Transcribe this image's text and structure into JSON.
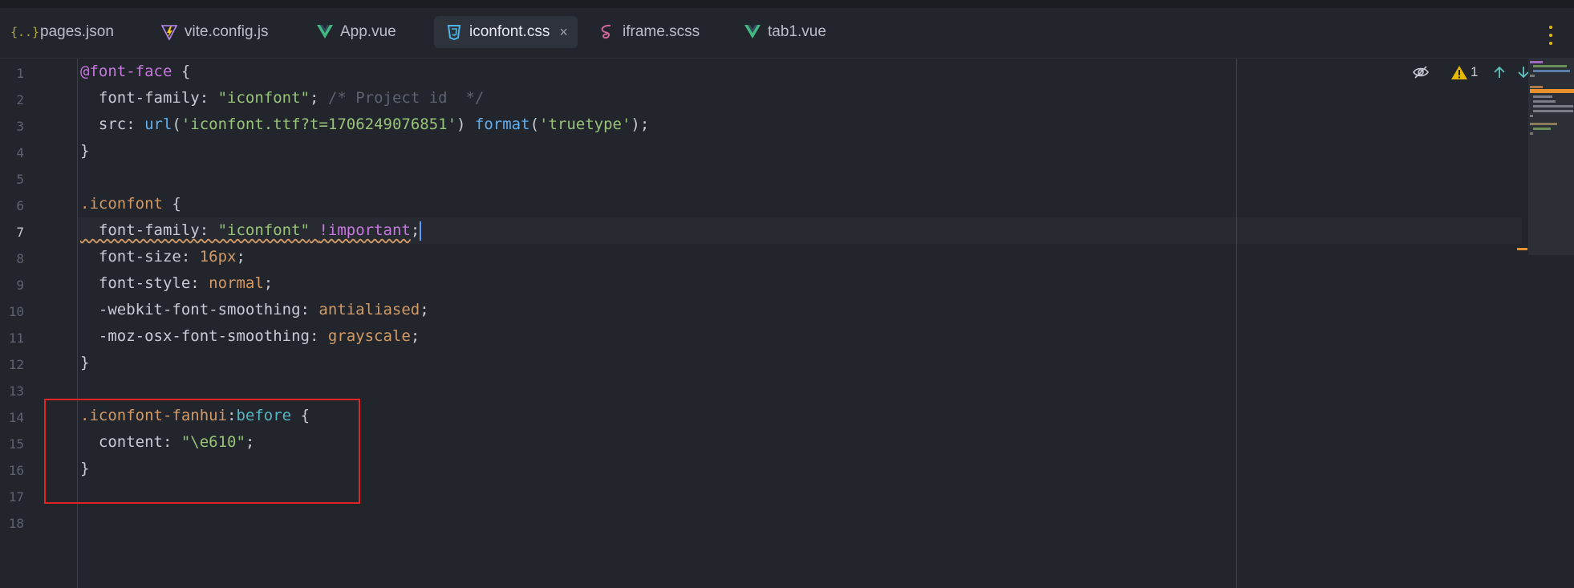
{
  "tabs": [
    {
      "name": "pages.json",
      "icon": "json-braces-icon",
      "active": false
    },
    {
      "name": "vite.config.js",
      "icon": "vite-icon",
      "active": false
    },
    {
      "name": "App.vue",
      "icon": "vue-icon",
      "active": false
    },
    {
      "name": "iconfont.css",
      "icon": "css-icon",
      "active": true,
      "close": "×"
    },
    {
      "name": "iframe.scss",
      "icon": "sass-icon",
      "active": false
    },
    {
      "name": "tab1.vue",
      "icon": "vue-icon",
      "active": false
    }
  ],
  "json_icon_text": "{..}",
  "line_numbers": [
    "1",
    "2",
    "3",
    "4",
    "5",
    "6",
    "7",
    "8",
    "9",
    "10",
    "11",
    "12",
    "13",
    "14",
    "15",
    "16",
    "17",
    "18"
  ],
  "current_line": "7",
  "code": {
    "l1": {
      "at": "@font-face",
      "brace": " {"
    },
    "l2": {
      "prop": "  font-family: ",
      "val": "\"iconfont\"",
      "semi": "; ",
      "comment": "/* Project id  */"
    },
    "l3": {
      "prop": "  src: ",
      "url_fn": "url",
      "p1": "(",
      "url_val": "'iconfont.ttf?t=1706249076851'",
      "p2": ") ",
      "fmt_fn": "format",
      "p3": "(",
      "fmt_val": "'truetype'",
      "p4": ");"
    },
    "l4": "}",
    "l6": {
      "sel": ".iconfont",
      "brace": " {"
    },
    "l7": {
      "prop": "  font-family: ",
      "val": "\"iconfont\"",
      "sp": " ",
      "imp": "!important",
      "semi": ";"
    },
    "l8": {
      "prop": "  font-size: ",
      "val": "16px",
      "semi": ";"
    },
    "l9": {
      "prop": "  font-style: ",
      "val": "normal",
      "semi": ";"
    },
    "l10": {
      "prop": "  -webkit-font-smoothing: ",
      "val": "antialiased",
      "semi": ";"
    },
    "l11": {
      "prop": "  -moz-osx-font-smoothing: ",
      "val": "grayscale",
      "semi": ";"
    },
    "l12": "}",
    "l14": {
      "sel": ".iconfont-fanhui",
      "colon": ":",
      "pseudo": "before",
      "brace": " {"
    },
    "l15": {
      "prop": "  content: ",
      "val": "\"\\e610\"",
      "semi": ";"
    },
    "l16": "}"
  },
  "inspections": {
    "warning_count": "1"
  },
  "colors": {
    "highlight_box": "#e02424",
    "accent_caret": "#5b9cf5",
    "warning": "#e6b800"
  }
}
